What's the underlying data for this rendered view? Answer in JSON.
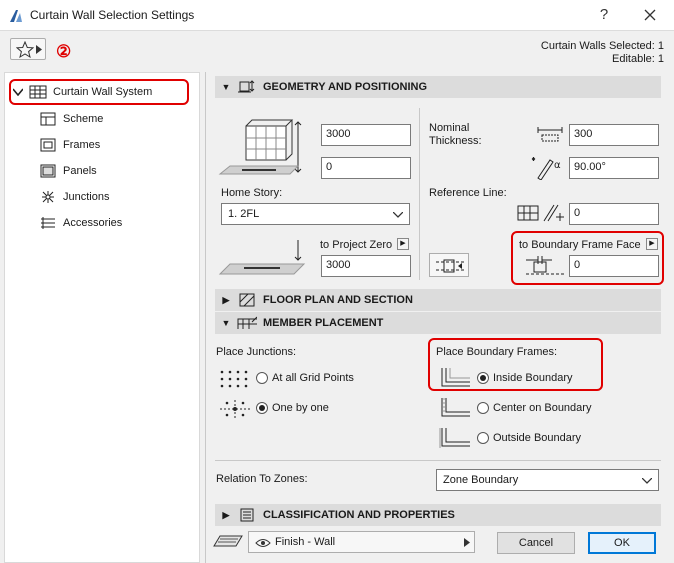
{
  "window": {
    "title": "Curtain Wall Selection Settings",
    "help_label": "?",
    "close_label": "X"
  },
  "header": {
    "annotation_number": "②",
    "selected_text": "Curtain Walls Selected: 1",
    "editable_text": "Editable: 1"
  },
  "tree": {
    "root_label": "Curtain Wall System",
    "items": [
      {
        "label": "Scheme",
        "icon": "scheme-icon"
      },
      {
        "label": "Frames",
        "icon": "frames-icon"
      },
      {
        "label": "Panels",
        "icon": "panels-icon"
      },
      {
        "label": "Junctions",
        "icon": "junctions-icon"
      },
      {
        "label": "Accessories",
        "icon": "accessories-icon"
      }
    ]
  },
  "geometry": {
    "header": "GEOMETRY AND POSITIONING",
    "height_value": "3000",
    "offset_value": "0",
    "home_story_label": "Home Story:",
    "home_story_value": "1. 2FL",
    "to_project_zero_label": "to Project Zero",
    "project_zero_value": "3000",
    "nominal_thickness_label": "Nominal Thickness:",
    "thickness_value": "300",
    "angle_value": "90.00°",
    "reference_line_label": "Reference Line:",
    "ref_offset_value": "0",
    "boundary_face_label": "to Boundary Frame Face",
    "boundary_face_value": "0"
  },
  "floor_plan": {
    "header": "FLOOR PLAN AND SECTION"
  },
  "member_placement": {
    "header": "MEMBER PLACEMENT",
    "place_junctions_label": "Place Junctions:",
    "junction_options": [
      "At all Grid Points",
      "One by one"
    ],
    "junction_selected": 1,
    "place_boundary_label": "Place Boundary Frames:",
    "boundary_options": [
      "Inside Boundary",
      "Center on Boundary",
      "Outside Boundary"
    ],
    "boundary_selected": 0,
    "relation_label": "Relation To Zones:",
    "relation_value": "Zone Boundary"
  },
  "classification": {
    "header": "CLASSIFICATION AND PROPERTIES"
  },
  "footer": {
    "view_value": "Finish - Wall",
    "cancel_label": "Cancel",
    "ok_label": "OK"
  },
  "colors": {
    "highlight": "#e00000",
    "accent": "#0078d7"
  }
}
